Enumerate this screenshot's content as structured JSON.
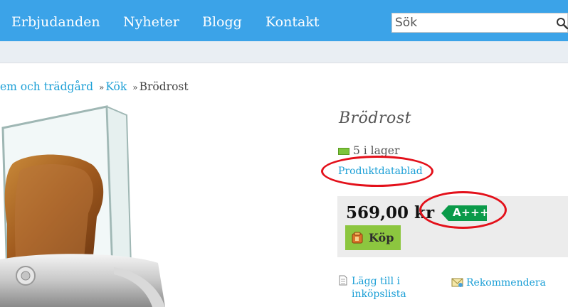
{
  "nav": {
    "items": [
      {
        "label": "Erbjudanden"
      },
      {
        "label": "Nyheter"
      },
      {
        "label": "Blogg"
      },
      {
        "label": "Kontakt"
      }
    ],
    "search_placeholder": "Sök"
  },
  "breadcrumb": {
    "items": [
      {
        "label": "em och trädgård"
      },
      {
        "label": "Kök"
      },
      {
        "label": "Brödrost"
      }
    ],
    "separator": "»"
  },
  "product": {
    "title": "Brödrost",
    "stock": "5 i lager",
    "datasheet_link": "Produktdatablad",
    "price": "569,00 kr",
    "energy_class": "A+++",
    "buy_label": "Köp",
    "add_to_list": "Lägg till i inköpslista",
    "recommend": "Rekommendera"
  },
  "colors": {
    "nav_bg": "#3ba3e8",
    "link": "#1b9fd6",
    "energy_green": "#0a9a49",
    "buy_green": "#8cc63f",
    "annotation_red": "#e3101a"
  },
  "icons": [
    "search-icon",
    "stock-icon",
    "cart-icon",
    "document-icon",
    "envelope-icon"
  ]
}
